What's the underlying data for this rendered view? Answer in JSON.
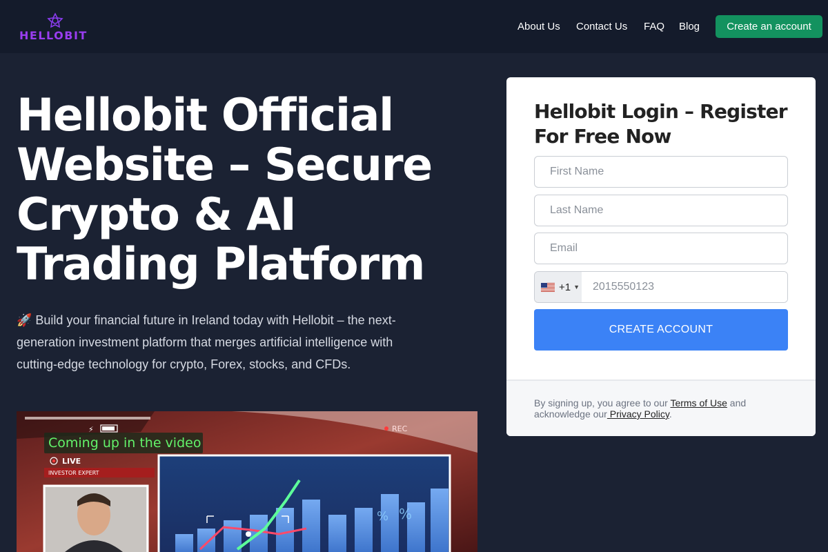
{
  "header": {
    "logo_text": "HELLOBIT",
    "nav": {
      "about": "About Us",
      "contact": "Contact Us",
      "faq": "FAQ",
      "blog": "Blog"
    },
    "cta": "Create an account"
  },
  "hero": {
    "title": "Hellobit Official Website – Secure Crypto & AI Trading Platform",
    "description": "🚀 Build your financial future in Ireland today with Hellobit – the next-generation investment platform that merges artificial intelligence with cutting-edge technology for crypto, Forex, stocks, and CFDs."
  },
  "video": {
    "caption": "Coming up in the video",
    "live_label": "LIVE",
    "live_sublabel": "INVESTOR EXPERT",
    "rec_label": "REC"
  },
  "form": {
    "title": "Hellobit Login – Register For Free Now",
    "first_name_placeholder": "First Name",
    "last_name_placeholder": "Last Name",
    "email_placeholder": "Email",
    "phone_code": "+1",
    "phone_placeholder": "2015550123",
    "submit": "CREATE ACCOUNT",
    "terms_prefix": "By signing up, you agree to our ",
    "terms_link": "Terms of Use",
    "terms_mid": " and acknowledge our",
    "privacy_link": " Privacy Policy",
    "terms_suffix": "."
  },
  "colors": {
    "page_bg": "#1b2233",
    "header_bg": "#141b2b",
    "accent_green": "#13925f",
    "accent_blue": "#3b82f6",
    "logo_purple": "#9a3df0"
  }
}
